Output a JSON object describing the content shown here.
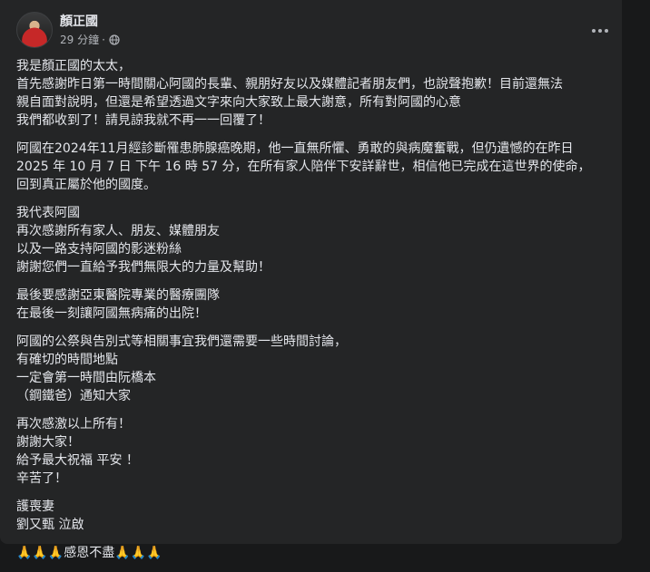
{
  "post": {
    "author": "顏正國",
    "time": "29 分鐘",
    "separator": "·",
    "privacy_icon": "globe-icon",
    "more_icon": "more-horizontal-icon"
  },
  "paragraphs": [
    [
      "我是顏正國的太太，",
      "首先感謝昨日第一時間關心阿國的長輩、親朋好友以及媒體記者朋友們，也說聲抱歉！目前還無法",
      "親自面對說明，但還是希望透過文字來向大家致上最大謝意，所有對阿國的心意",
      "我們都收到了！請見諒我就不再一一回覆了！"
    ],
    [
      "阿國在2024年11月經診斷罹患肺腺癌晚期，他一直無所懼、勇敢的與病魔奮戰，但仍遺憾的在昨日",
      "2025 年 10 月 7 日 下午 16 時 57 分，在所有家人陪伴下安詳辭世，相信他已完成在這世界的使命，",
      "回到真正屬於他的國度。"
    ],
    [
      "我代表阿國",
      "再次感謝所有家人、朋友、媒體朋友",
      "以及一路支持阿國的影迷粉絲",
      "謝謝您們一直給予我們無限大的力量及幫助！"
    ],
    [
      "最後要感謝亞東醫院專業的醫療團隊",
      "在最後一刻讓阿國無病痛的出院！"
    ],
    [
      "阿國的公祭與告別式等相關事宜我們還需要一些時間討論，",
      "有確切的時間地點",
      "一定會第一時間由阮橋本",
      "（鋼鐵爸）通知大家"
    ],
    [
      "再次感激以上所有！",
      "謝謝大家！",
      "給予最大祝福 平安 ！",
      "辛苦了！"
    ],
    [
      "護喪妻",
      "劉又甄 泣啟"
    ],
    [
      "🙏🙏🙏感恩不盡🙏🙏🙏"
    ]
  ]
}
